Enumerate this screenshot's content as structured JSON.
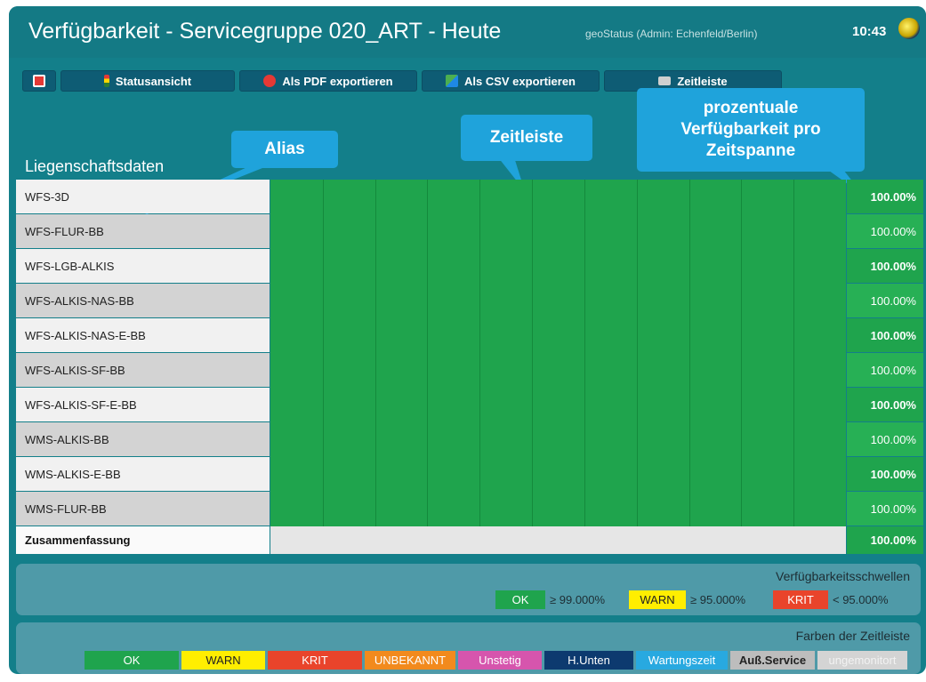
{
  "header": {
    "title": "Verfügbarkeit - Servicegruppe 020_ART - Heute",
    "user": "geoStatus (Admin: Echenfeld/Berlin)",
    "clock": "10:43"
  },
  "toolbar": {
    "status_label": "Statusansicht",
    "pdf_label": "Als PDF exportieren",
    "csv_label": "Als CSV exportieren",
    "timeline_label": "Zeitleiste"
  },
  "callouts": {
    "alias": "Alias",
    "zeitleiste": "Zeitleiste",
    "prozent": "prozentuale Verfügbarkeit pro Zeitspanne"
  },
  "section_label": "Liegenschaftsdaten",
  "rows": [
    {
      "alias": "WFS-3D",
      "percent": "100.00%",
      "bold": true
    },
    {
      "alias": "WFS-FLUR-BB",
      "percent": "100.00%",
      "bold": false
    },
    {
      "alias": "WFS-LGB-ALKIS",
      "percent": "100.00%",
      "bold": true
    },
    {
      "alias": "WFS-ALKIS-NAS-BB",
      "percent": "100.00%",
      "bold": false
    },
    {
      "alias": "WFS-ALKIS-NAS-E-BB",
      "percent": "100.00%",
      "bold": true
    },
    {
      "alias": "WFS-ALKIS-SF-BB",
      "percent": "100.00%",
      "bold": false
    },
    {
      "alias": "WFS-ALKIS-SF-E-BB",
      "percent": "100.00%",
      "bold": true
    },
    {
      "alias": "WMS-ALKIS-BB",
      "percent": "100.00%",
      "bold": false
    },
    {
      "alias": "WMS-ALKIS-E-BB",
      "percent": "100.00%",
      "bold": true
    },
    {
      "alias": "WMS-FLUR-BB",
      "percent": "100.00%",
      "bold": false
    }
  ],
  "summary": {
    "label": "Zusammenfassung",
    "percent": "100.00%"
  },
  "thresholds": {
    "title": "Verfügbarkeitsschwellen",
    "ok_label": "OK",
    "ok_value": "≥ 99.000%",
    "warn_label": "WARN",
    "warn_value": "≥ 95.000%",
    "krit_label": "KRIT",
    "krit_value": "< 95.000%"
  },
  "legend": {
    "title": "Farben der Zeitleiste",
    "items": [
      {
        "label": "OK",
        "color": "#1fa44d"
      },
      {
        "label": "WARN",
        "color": "#ffee00"
      },
      {
        "label": "KRIT",
        "color": "#e9442b"
      },
      {
        "label": "UNBEKANNT",
        "color": "#f28a1d"
      },
      {
        "label": "Unstetig",
        "color": "#d655ad"
      },
      {
        "label": "H.Unten",
        "color": "#0d3a6f"
      },
      {
        "label": "Wartungszeit",
        "color": "#28a9e0"
      },
      {
        "label": "Auß.Service",
        "color": "#bdbdbd"
      },
      {
        "label": "ungemonitort",
        "color": "#d4d4d4"
      }
    ]
  },
  "colors": {
    "ok": "#1fa44d",
    "background": "#137f8a",
    "accent": "#1fa3db"
  }
}
